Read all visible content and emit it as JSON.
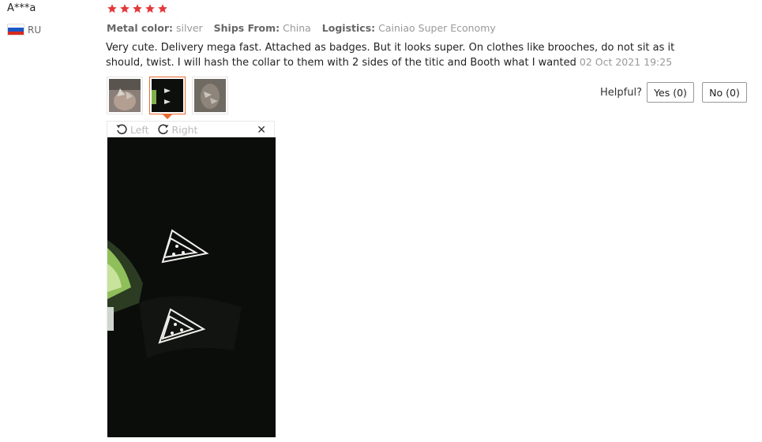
{
  "reviewer": {
    "name": "A***a",
    "country": "RU"
  },
  "rating": {
    "stars": 5,
    "max": 5,
    "color": "#e4393c"
  },
  "meta": {
    "color_label": "Metal color:",
    "color_value": "silver",
    "ships_label": "Ships From:",
    "ships_value": "China",
    "logistics_label": "Logistics:",
    "logistics_value": "Cainiao Super Economy"
  },
  "review": {
    "text": "Very cute. Delivery mega fast. Attached as badges. But it looks super. On clothes like brooches, do not sit as it should, twist. I will hash the collar to them with 2 sides of the titic and Booth what I wanted",
    "date": "02 Oct 2021 19:25"
  },
  "thumbnails": {
    "count": 3,
    "selected_index": 1
  },
  "helpful": {
    "label": "Helpful?",
    "yes_label": "Yes (0)",
    "no_label": "No (0)"
  },
  "viewer": {
    "rotate_left_label": "Left",
    "rotate_right_label": "Right",
    "close_icon": "close-icon"
  },
  "colors": {
    "accent": "#e86a2f",
    "star": "#e4393c"
  }
}
